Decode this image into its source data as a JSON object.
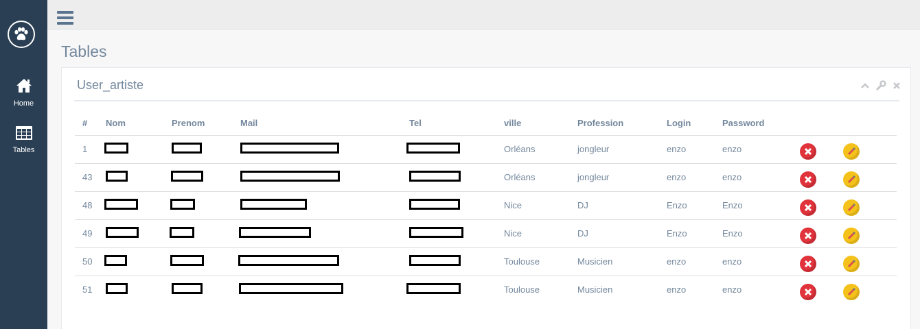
{
  "sidebar": {
    "logo_icon": "paw-icon",
    "items": [
      {
        "label": "Home",
        "icon": "home-icon"
      },
      {
        "label": "Tables",
        "icon": "table-icon"
      }
    ]
  },
  "topbar": {
    "menu_icon": "hamburger-menu-icon"
  },
  "page": {
    "title": "Tables"
  },
  "panel": {
    "title": "User_artiste",
    "tools": [
      "chevron-up-icon",
      "wrench-icon",
      "close-icon"
    ]
  },
  "table": {
    "columns": [
      "#",
      "Nom",
      "Prenom",
      "Mail",
      "Tel",
      "ville",
      "Profession",
      "Login",
      "Password"
    ],
    "rows": [
      {
        "id": "1",
        "ville": "Orléans",
        "profession": "jongleur",
        "login": "enzo",
        "password": "enzo"
      },
      {
        "id": "43",
        "ville": "Orléans",
        "profession": "jongleur",
        "login": "enzo",
        "password": "enzo"
      },
      {
        "id": "48",
        "ville": "Nice",
        "profession": "DJ",
        "login": "Enzo",
        "password": "Enzo"
      },
      {
        "id": "49",
        "ville": "Nice",
        "profession": "DJ",
        "login": "Enzo",
        "password": "Enzo"
      },
      {
        "id": "50",
        "ville": "Toulouse",
        "profession": "Musicien",
        "login": "enzo",
        "password": "enzo"
      },
      {
        "id": "51",
        "ville": "Toulouse",
        "profession": "Musicien",
        "login": "enzo",
        "password": "enzo"
      }
    ],
    "row_actions": [
      "delete-icon",
      "edit-icon"
    ]
  },
  "colors": {
    "sidebar_bg": "#2a3f54",
    "text": "#73879c",
    "delete": "#e0333b",
    "edit": "#f4c21a"
  }
}
